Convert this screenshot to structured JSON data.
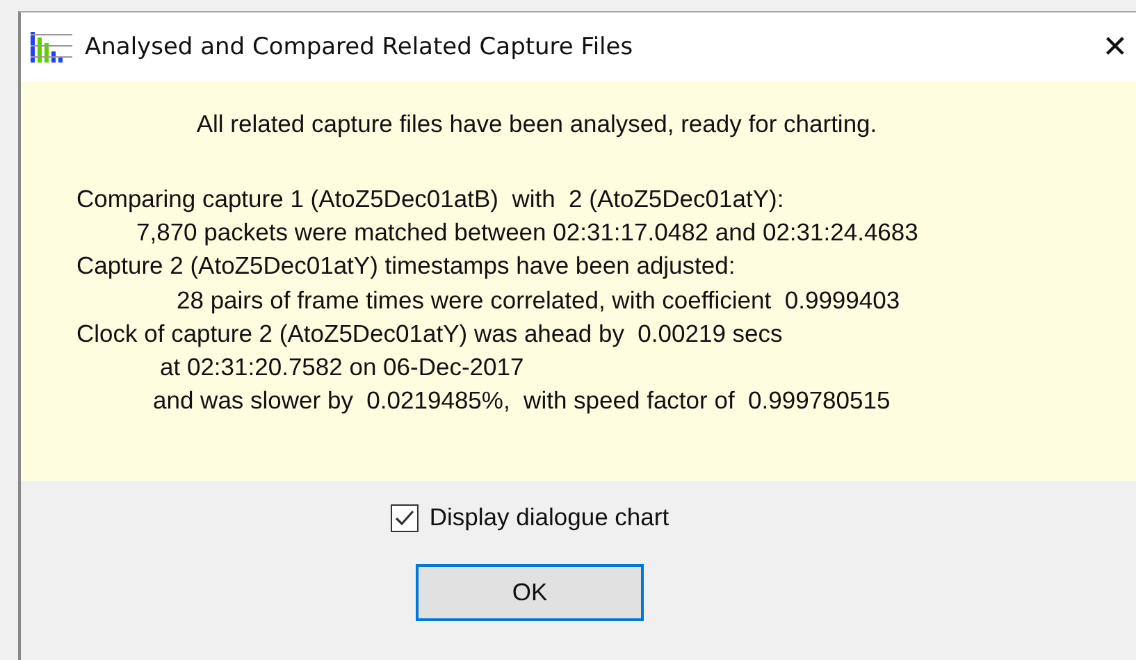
{
  "window": {
    "title": "Analysed and Compared Related Capture Files",
    "close": "✕"
  },
  "summary": "All related capture files have been analysed, ready for charting.",
  "lines": [
    {
      "kind": "main",
      "text": "Comparing capture 1 (AtoZ5Dec01atB)  with  2 (AtoZ5Dec01atY):"
    },
    {
      "kind": "detail",
      "text": "7,870 packets were matched between 02:31:17.0482 and 02:31:24.4683"
    },
    {
      "kind": "main",
      "text": "Capture 2 (AtoZ5Dec01atY) timestamps have been adjusted:"
    },
    {
      "kind": "coefficient",
      "text": "28 pairs of frame times were correlated, with coefficient  0.9999403"
    },
    {
      "kind": "main",
      "text": "Clock of capture 2 (AtoZ5Dec01atY) was ahead by  0.00219 secs"
    },
    {
      "kind": "moment",
      "text": "at 02:31:20.7582 on 06-Dec-2017"
    },
    {
      "kind": "rate",
      "text": "and was slower by  0.0219485%,  with speed factor of  0.999780515"
    }
  ],
  "checkbox": {
    "label": "Display dialogue chart",
    "checked": true
  },
  "buttons": [
    {
      "label": "OK",
      "selected": true
    }
  ]
}
